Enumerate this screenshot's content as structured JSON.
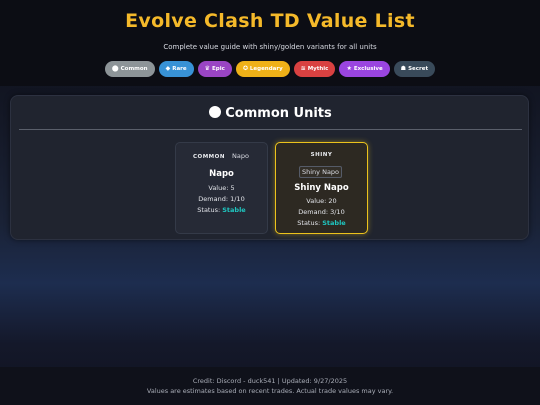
{
  "header": {
    "title": "Evolve Clash TD Value List",
    "subtitle": "Complete value guide with shiny/golden variants for all units"
  },
  "nav": {
    "items": [
      {
        "label": "Common",
        "icon": "circle-icon",
        "color": "#8d9498"
      },
      {
        "label": "Rare",
        "icon": "diamond-icon",
        "color": "#3892d6"
      },
      {
        "label": "Epic",
        "icon": "crown-icon",
        "color": "#9a45c4"
      },
      {
        "label": "Legendary",
        "icon": "star-badge-icon",
        "color": "#efb118"
      },
      {
        "label": "Mythic",
        "icon": "dragon-icon",
        "color": "#d94141"
      },
      {
        "label": "Exclusive",
        "icon": "star-icon",
        "color": "#9a45e0"
      },
      {
        "label": "Secret",
        "icon": "spy-icon",
        "color": "#394a5a"
      }
    ]
  },
  "section": {
    "title": "Common Units",
    "icon": "white-circle-icon"
  },
  "cards": [
    {
      "rarity": "COMMON",
      "image_alt": "Napo",
      "name": "Napo",
      "value": "Value: 5",
      "demand": "Demand: 1/10",
      "status_label": "Status:",
      "status": "Stable"
    },
    {
      "rarity": "SHINY",
      "image_alt": "Shiny Napo",
      "name": "Shiny Napo",
      "value": "Value: 20",
      "demand": "Demand: 3/10",
      "status_label": "Status:",
      "status": "Stable"
    }
  ],
  "footer": {
    "credit": "Credit: Discord - duck541 | Updated: 9/27/2025",
    "disclaimer": "Values are estimates based on recent trades. Actual trade values may vary."
  },
  "colors": {
    "title": "#f5b92a",
    "stable": "#1fc7c1",
    "shiny_border": "#ecc31c"
  }
}
